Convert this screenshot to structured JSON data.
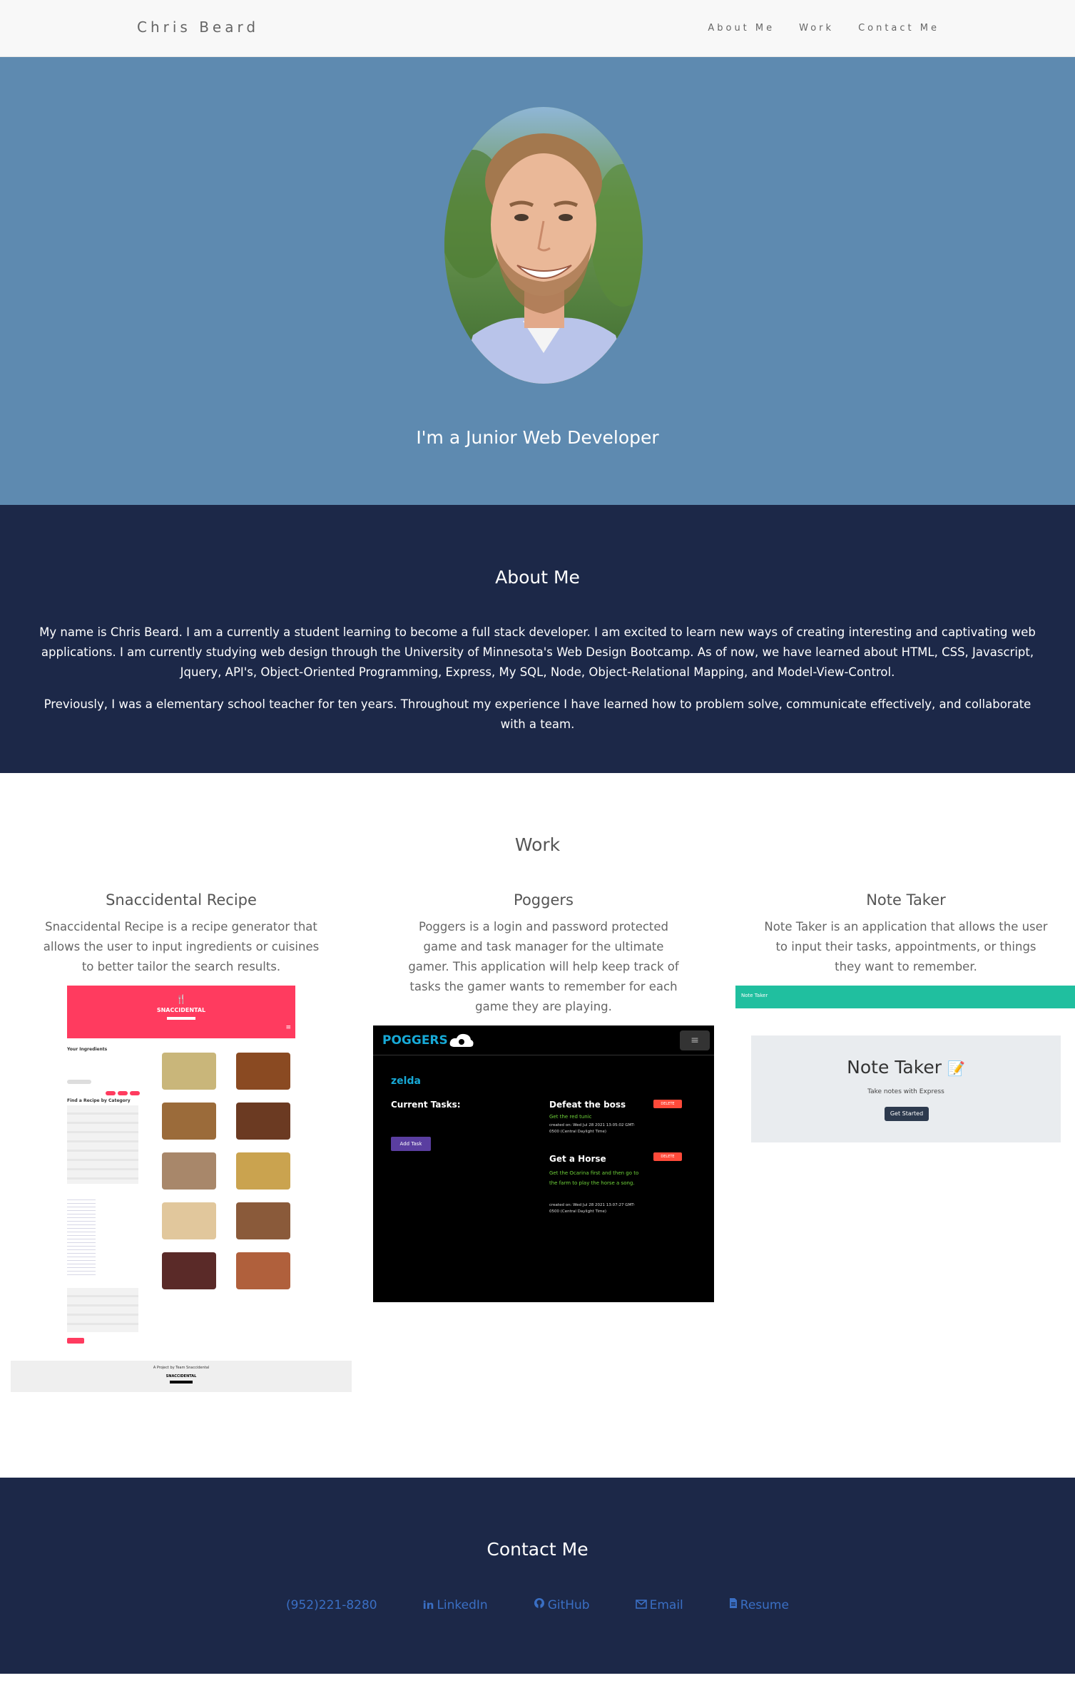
{
  "nav": {
    "brand": "Chris Beard",
    "links": [
      "About Me",
      "Work",
      "Contact Me"
    ]
  },
  "hero": {
    "tagline": "I'm a Junior Web Developer"
  },
  "about": {
    "title": "About Me",
    "paragraph1": "My name is Chris Beard. I am a currently a student learning to become a full stack developer. I am excited to learn new ways of creating interesting and captivating web applications. I am currently studying web design through the University of Minnesota's Web Design Bootcamp. As of now, we have learned about HTML, CSS, Javascript, Jquery, API's, Object-Oriented Programming, Express, My SQL, Node, Object-Relational Mapping, and Model-View-Control.",
    "paragraph2": "Previously, I was a elementary school teacher for ten years. Throughout my experience I have learned how to problem solve, communicate effectively, and collaborate with a team."
  },
  "work": {
    "title": "Work",
    "projects": [
      {
        "title": "Snaccidental Recipe",
        "description": "Snaccidental Recipe is a recipe generator that allows the user to input ingredients or cuisines to better tailor the search results.",
        "shot": {
          "logo": "SNACCIDENTAL",
          "your_ingredients": "Your Ingredients",
          "find_by_category": "Find a Recipe by Category",
          "footer_text": "A Project by Team Snaccidental",
          "footer_logo": "SNACCIDENTAL"
        }
      },
      {
        "title": "Poggers",
        "description": "Poggers is a login and password protected game and task manager for the ultimate gamer. This application will help keep track of tasks the gamer wants to remember for each game they are playing.",
        "shot": {
          "brand": "POGGERS",
          "game": "zelda",
          "current_tasks": "Current Tasks:",
          "add_task": "Add Task",
          "delete": "DELETE",
          "tasks": [
            {
              "name": "Defeat the boss",
              "detail": "Get the red tunic",
              "created": "created on: Wed Jul 28 2021 13:05:02 GMT-0500 (Central Daylight Time)"
            },
            {
              "name": "Get a Horse",
              "detail": "Get the Ocarina first and then go to the farm to play the horse a song.",
              "created": "created on: Wed Jul 28 2021 13:07:27 GMT-0500 (Central Daylight Time)"
            }
          ]
        }
      },
      {
        "title": "Note Taker",
        "description": "Note Taker is an application that allows the user to input their tasks, appointments, or things they want to remember.",
        "shot": {
          "nav_label": "Note Taker",
          "heading": "Note Taker",
          "sub": "Take notes with Express",
          "cta": "Get Started"
        }
      }
    ]
  },
  "contact": {
    "title": "Contact Me",
    "links": [
      {
        "label": "(952)221-8280",
        "icon": ""
      },
      {
        "label": "LinkedIn",
        "icon": "linkedin-icon"
      },
      {
        "label": "GitHub",
        "icon": "github-icon"
      },
      {
        "label": "Email",
        "icon": "envelope-icon"
      },
      {
        "label": "Resume",
        "icon": "file-icon"
      }
    ]
  },
  "colors": {
    "hero_bg": "#5e8ab0",
    "dark_bg": "#1c2848",
    "snacc_pink": "#ff3b5f",
    "poggers_cyan": "#17a9d6",
    "note_green": "#20bf9f"
  }
}
